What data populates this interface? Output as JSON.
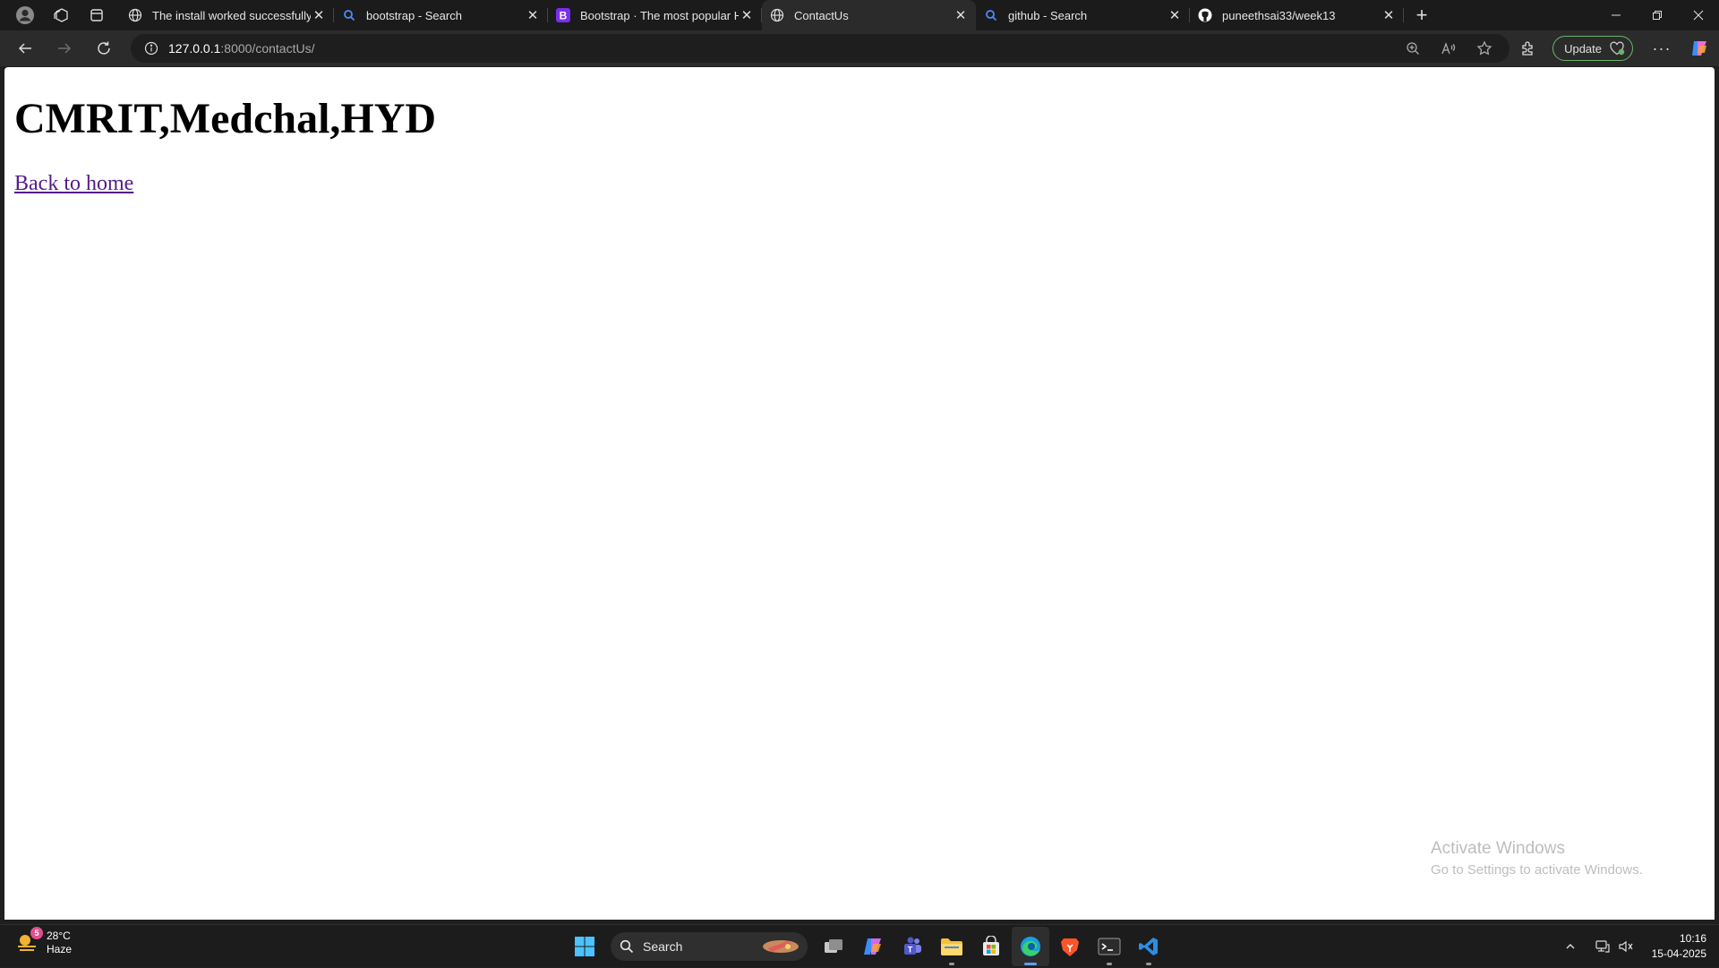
{
  "tabs": [
    {
      "title": "The install worked successfully! Congratulations!",
      "favicon": "globe-icon",
      "active": false
    },
    {
      "title": "bootstrap - Search",
      "favicon": "search-icon",
      "active": false
    },
    {
      "title": "Bootstrap · The most popular HTML, CSS, and JS library",
      "favicon": "bootstrap-icon",
      "active": false
    },
    {
      "title": "ContactUs",
      "favicon": "globe-icon",
      "active": true
    },
    {
      "title": "github - Search",
      "favicon": "search-icon",
      "active": false
    },
    {
      "title": "puneethsai33/week13",
      "favicon": "github-icon",
      "active": false
    }
  ],
  "address_bar": {
    "host": "127.0.0.1",
    "rest": ":8000/contactUs/"
  },
  "toolbar": {
    "update_label": "Update"
  },
  "page": {
    "heading": "CMRIT,Medchal,HYD",
    "link_text": "Back to home"
  },
  "watermark": {
    "line1": "Activate Windows",
    "line2": "Go to Settings to activate Windows."
  },
  "taskbar": {
    "weather_temp": "28°C",
    "weather_desc": "Haze",
    "weather_badge": "5",
    "search_label": "Search",
    "time": "10:16",
    "date": "15-04-2025"
  },
  "colors": {
    "tab_strip_bg": "#1b1b1b",
    "toolbar_bg": "#2b2b2b",
    "visited_link": "#551a8b",
    "update_border": "#6bb36b",
    "taskbar_bg": "#1c1c1c"
  }
}
